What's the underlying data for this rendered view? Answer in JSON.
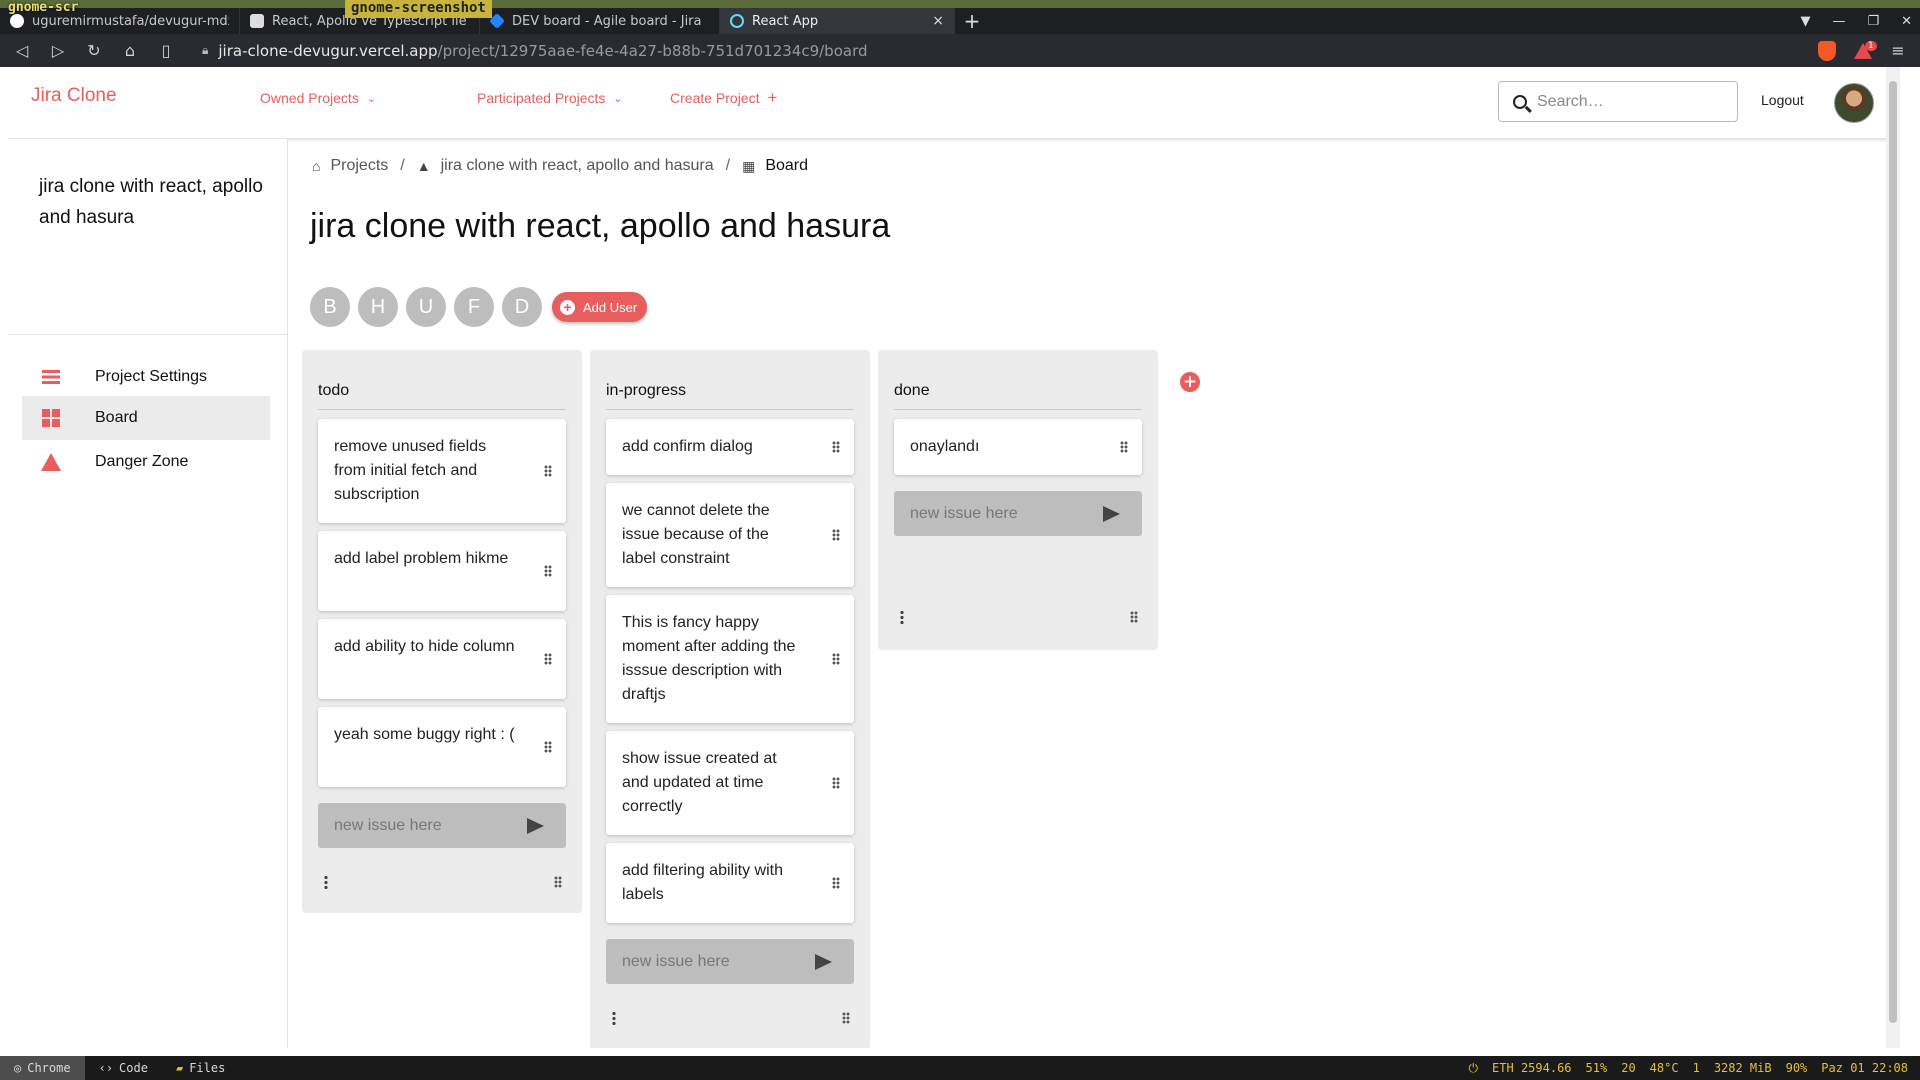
{
  "desktop": {
    "overlay1": "gnome-scr",
    "overlay2": "gnome-screenshot"
  },
  "browser": {
    "tabs": [
      {
        "title": "uguremirmustafa/devugur-mdx",
        "icon_color": "#ffffff"
      },
      {
        "title": "React, Apollo ve Typescript ile",
        "icon_color": "#dddddd"
      },
      {
        "title": "DEV board - Agile board - Jira",
        "icon_color": "#2684ff"
      },
      {
        "title": "React App",
        "icon_color": "#61dafb"
      }
    ],
    "close_icon": "×",
    "new_tab": "+",
    "url_host": "jira-clone-devugur.vercel.app",
    "url_path": "/project/12975aae-fe4e-4a27-b88b-751d701234c9/board",
    "notification_count": "1"
  },
  "app": {
    "logo": "Jira Clone",
    "nav": [
      {
        "label": "Owned Projects",
        "icon": "chevron-down-icon"
      },
      {
        "label": "Participated Projects",
        "icon": "chevron-down-icon"
      },
      {
        "label": "Create Project",
        "icon": "plus-icon"
      }
    ],
    "search_placeholder": "Search…",
    "logout": "Logout",
    "accent": "#e85d5d"
  },
  "sidebar": {
    "project_title": "jira clone with react, apollo and hasura",
    "items": [
      {
        "label": "Project Settings",
        "icon": "list-icon",
        "active": false
      },
      {
        "label": "Board",
        "icon": "dashboard-icon",
        "active": true
      },
      {
        "label": "Danger Zone",
        "icon": "warning-icon",
        "active": false
      }
    ]
  },
  "breadcrumb": {
    "items": [
      {
        "label": "Projects",
        "icon": "home-icon"
      },
      {
        "label": "jira clone with react, apollo and hasura",
        "icon": "category-icon"
      },
      {
        "label": "Board",
        "icon": "dashboard-icon"
      }
    ],
    "separator": "/"
  },
  "board": {
    "title": "jira clone with react, apollo and hasura",
    "members": [
      "B",
      "H",
      "U",
      "F",
      "D"
    ],
    "add_user": "Add User",
    "new_issue_placeholder": "new issue here",
    "columns": [
      {
        "name": "todo",
        "cards": [
          "remove unused fields from initial fetch and subscription",
          "add label problem hikme",
          "add ability to hide column",
          "yeah some buggy right : ("
        ]
      },
      {
        "name": "in-progress",
        "cards": [
          "add confirm dialog",
          "we cannot delete the issue because of the label constraint",
          "This is fancy happy moment after adding the isssue description with draftjs",
          "show issue created at and updated at time correctly",
          "add filtering ability with labels"
        ]
      },
      {
        "name": "done",
        "cards": [
          "onaylandı"
        ]
      }
    ]
  },
  "taskbar": {
    "apps": [
      "Chrome",
      "Code",
      "Files"
    ],
    "status": [
      "ETH 2594.66",
      "51%",
      "20",
      "48°C",
      "1",
      "3282 MiB",
      "90%",
      "Paz 01 22:08"
    ]
  }
}
